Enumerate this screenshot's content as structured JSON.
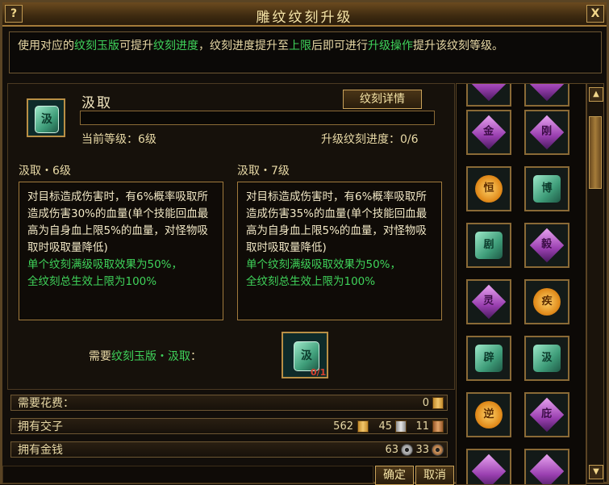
{
  "window": {
    "title": "雕纹纹刻升级",
    "help": "?",
    "close": "X"
  },
  "description": {
    "p1": "使用对应的",
    "g1": "纹刻玉版",
    "p2": "可提升",
    "g2": "纹刻进度",
    "p3": "，纹刻进度提升至",
    "g3": "上限",
    "p4": "后即可进行",
    "g4": "升级操作",
    "p5": "提升该纹刻等级。"
  },
  "skill": {
    "icon_glyph": "汲",
    "name": "汲取",
    "detail_button": "纹刻详情",
    "level_text": "当前等级：6级",
    "progress_text": "升级纹刻进度：0/6",
    "progress_fraction": 0
  },
  "current": {
    "header": "汲取・6级",
    "desc": "对目标造成伤害时，有6%概率吸取所造成伤害30%的血量(单个技能回血最高为自身血上限5%的血量，对怪物吸取时吸取量降低)",
    "green1": "单个纹刻满级吸取效果为50%，",
    "green2": "全纹刻总生效上限为100%"
  },
  "next": {
    "header": "汲取・7级",
    "desc": "对目标造成伤害时，有6%概率吸取所造成伤害35%的血量(单个技能回血最高为自身血上限5%的血量，对怪物吸取时吸取量降低)",
    "green1": "单个纹刻满级吸取效果为50%，",
    "green2": "全纹刻总生效上限为100%"
  },
  "need": {
    "prefix": "需要",
    "item": "纹刻玉版・汲取",
    "suffix": "：",
    "count": "0/1"
  },
  "costs": {
    "cost_label": "需要花费：",
    "cost_value": "0",
    "own_jiaozi_label": "拥有交子",
    "jiaozi_gold": "562",
    "jiaozi_silver": "45",
    "jiaozi_copper": "11",
    "own_money_label": "拥有金钱",
    "money_silver": "63",
    "money_copper": "33"
  },
  "buttons": {
    "confirm": "确定",
    "cancel": "取消"
  },
  "grid": [
    {
      "type": "purple",
      "glyph": ""
    },
    {
      "type": "purple",
      "glyph": ""
    },
    {
      "type": "purple",
      "glyph": "金"
    },
    {
      "type": "purple",
      "glyph": "刚"
    },
    {
      "type": "orange",
      "glyph": "恒"
    },
    {
      "type": "jadeg",
      "glyph": "博"
    },
    {
      "type": "jadeg",
      "glyph": "剧"
    },
    {
      "type": "purple",
      "glyph": "毅"
    },
    {
      "type": "purple",
      "glyph": "灵"
    },
    {
      "type": "orange",
      "glyph": "疾"
    },
    {
      "type": "jadeg",
      "glyph": "辟"
    },
    {
      "type": "jadeg",
      "glyph": "汲"
    },
    {
      "type": "orange",
      "glyph": "逆"
    },
    {
      "type": "purple",
      "glyph": "庇"
    },
    {
      "type": "purple",
      "glyph": ""
    },
    {
      "type": "purple",
      "glyph": ""
    }
  ],
  "colors": {
    "accent_green": "#3fd35a",
    "gold_border": "#b98f45"
  }
}
